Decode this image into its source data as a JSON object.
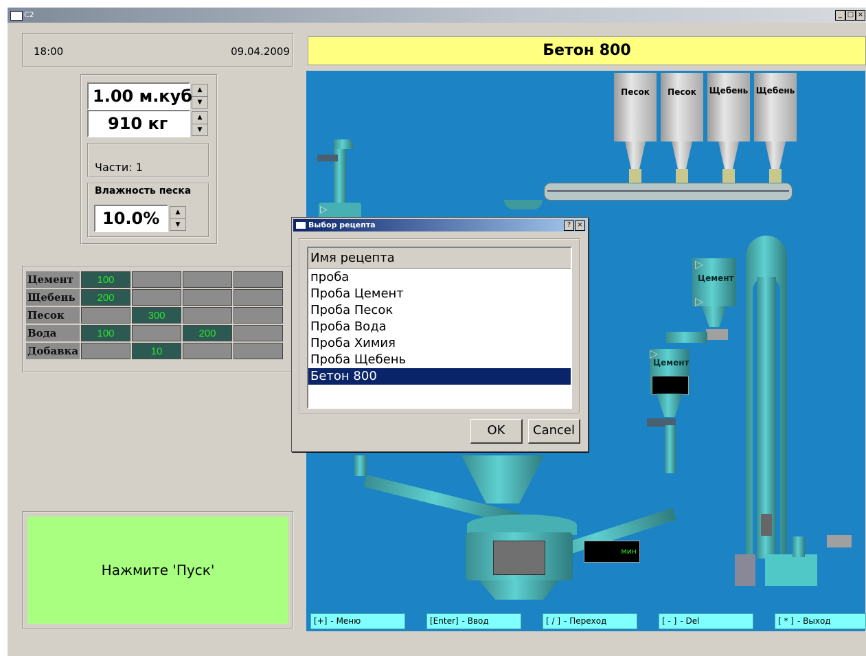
{
  "window": {
    "title": "C2",
    "min_label": "_",
    "max_label": "□",
    "close_label": "×"
  },
  "header": {
    "time": "18:00",
    "date": "09.04.2009",
    "recipe_title": "Бетон 800"
  },
  "volume": {
    "value": "1.00 м.куб"
  },
  "weight": {
    "value": "910 кг"
  },
  "parts_label": "Части: 1",
  "humidity": {
    "label": "Влажность песка",
    "value": "10.0%"
  },
  "materials": [
    {
      "name": "Цемент",
      "cells": [
        "100",
        "",
        "",
        ""
      ]
    },
    {
      "name": "Щебень",
      "cells": [
        "200",
        "",
        "",
        ""
      ]
    },
    {
      "name": "Песок",
      "cells": [
        "",
        "300",
        "",
        ""
      ]
    },
    {
      "name": "Вода",
      "cells": [
        "100",
        "",
        "200",
        ""
      ]
    },
    {
      "name": "Добавка",
      "cells": [
        "",
        "10",
        "",
        ""
      ]
    }
  ],
  "start_prompt": "Нажмите 'Пуск'",
  "hoppers": [
    "Песок",
    "Песок",
    "Щебень",
    "Щебень"
  ],
  "cement_labels": [
    "Цемент",
    "Цемент"
  ],
  "timer_unit": "мин",
  "dialog": {
    "title": "Выбор рецепта",
    "help_label": "?",
    "close_label": "×",
    "column_header": "Имя рецепта",
    "items": [
      "проба",
      "Проба Цемент",
      "Проба Песок",
      "Проба Вода",
      "Проба Химия",
      "Проба Щебень",
      "Бетон 800"
    ],
    "selected_index": 6,
    "ok_label": "OK",
    "cancel_label": "Cancel"
  },
  "hotkeys": [
    {
      "key": "[+]",
      "desc": "- Меню"
    },
    {
      "key": "[Enter]",
      "desc": "- Ввод"
    },
    {
      "key": "[ / ]",
      "desc": "- Переход"
    },
    {
      "key": "[ - ]",
      "desc": "- Del"
    },
    {
      "key": "[ * ]",
      "desc": "- Выход"
    }
  ],
  "colors": {
    "scada_bg": "#1c84c4",
    "header_yellow": "#ffff80",
    "start_green": "#a8ff80",
    "hotkey_cyan": "#80ffff",
    "led_green": "#2fe02f"
  }
}
